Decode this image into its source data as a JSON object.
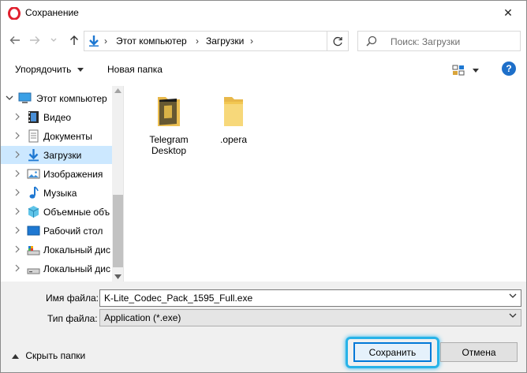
{
  "window": {
    "title": "Сохранение",
    "close_glyph": "✕"
  },
  "nav": {
    "breadcrumbs": [
      "Этот компьютер",
      "Загрузки"
    ],
    "search_placeholder": "Поиск: Загрузки"
  },
  "toolbar": {
    "organize": "Упорядочить",
    "new_folder": "Новая папка",
    "help": "?"
  },
  "tree": [
    {
      "label": "Этот компьютер",
      "icon": "computer-icon",
      "expanded": true
    },
    {
      "label": "Видео",
      "icon": "video-folder-icon"
    },
    {
      "label": "Документы",
      "icon": "documents-folder-icon"
    },
    {
      "label": "Загрузки",
      "icon": "downloads-folder-icon",
      "selected": true
    },
    {
      "label": "Изображения",
      "icon": "pictures-folder-icon"
    },
    {
      "label": "Музыка",
      "icon": "music-folder-icon"
    },
    {
      "label": "Объемные объ",
      "icon": "3d-objects-icon"
    },
    {
      "label": "Рабочий стол",
      "icon": "desktop-icon"
    },
    {
      "label": "Локальный дис",
      "icon": "drive-icon"
    },
    {
      "label": "Локальный дис",
      "icon": "drive-icon"
    }
  ],
  "files": [
    {
      "label_line1": "Telegram",
      "label_line2": "Desktop",
      "icon": "telegram-folder-icon"
    },
    {
      "label_line1": ".opera",
      "label_line2": "",
      "icon": "folder-icon"
    }
  ],
  "bottom": {
    "filename_label": "Имя файла:",
    "filename_value": "K-Lite_Codec_Pack_1595_Full.exe",
    "filetype_label": "Тип файла:",
    "filetype_value": "Application (*.exe)",
    "hide_folders": "Скрыть папки",
    "save": "Сохранить",
    "cancel": "Отмена"
  },
  "colors": {
    "accent": "#0078d7",
    "selection": "#cce8ff",
    "highlight_ring": "#27b3e8",
    "opera_red": "#e0202e"
  }
}
